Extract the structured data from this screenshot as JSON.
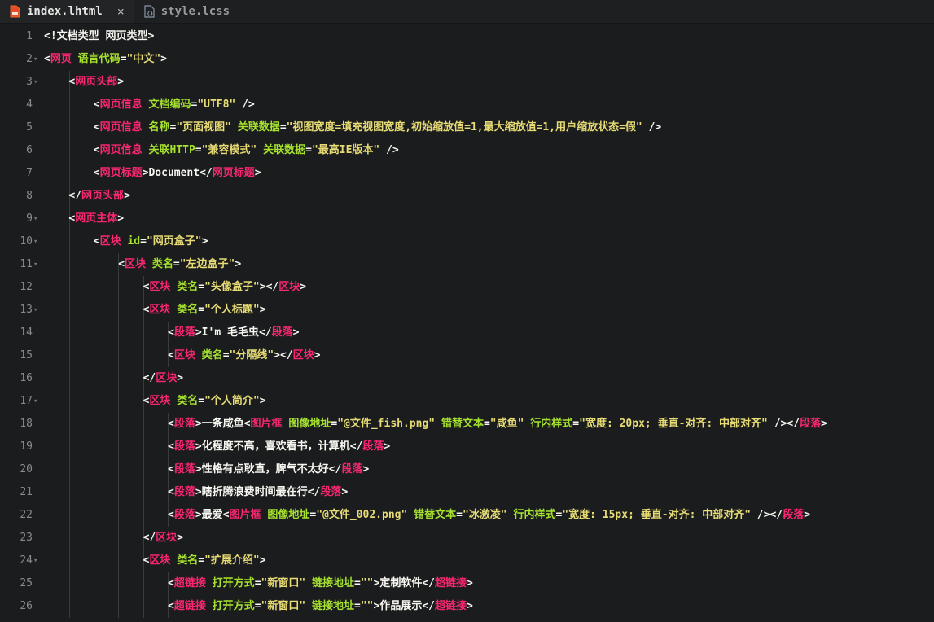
{
  "tabs": [
    {
      "label": "index.lhtml",
      "icon": "html-file-icon",
      "active": true
    },
    {
      "label": "style.lcss",
      "icon": "css-file-icon",
      "active": false
    }
  ],
  "close_glyph": "×",
  "lines": [
    {
      "n": "1",
      "fold": false,
      "indent": 0,
      "tokens": [
        [
          "p",
          "<!文档类型 网页类型>"
        ]
      ]
    },
    {
      "n": "2",
      "fold": true,
      "indent": 0,
      "tokens": [
        [
          "p",
          "<"
        ],
        [
          "t",
          "网页"
        ],
        [
          "x",
          " "
        ],
        [
          "a",
          "语言代码"
        ],
        [
          "p",
          "="
        ],
        [
          "s",
          "\"中文\""
        ],
        [
          "p",
          ">"
        ]
      ]
    },
    {
      "n": "3",
      "fold": true,
      "indent": 1,
      "tokens": [
        [
          "p",
          "<"
        ],
        [
          "t",
          "网页头部"
        ],
        [
          "p",
          ">"
        ]
      ]
    },
    {
      "n": "4",
      "fold": false,
      "indent": 2,
      "tokens": [
        [
          "p",
          "<"
        ],
        [
          "t",
          "网页信息"
        ],
        [
          "x",
          " "
        ],
        [
          "a",
          "文档编码"
        ],
        [
          "p",
          "="
        ],
        [
          "s",
          "\"UTF8\""
        ],
        [
          "x",
          " "
        ],
        [
          "p",
          "/>"
        ]
      ]
    },
    {
      "n": "5",
      "fold": false,
      "indent": 2,
      "tokens": [
        [
          "p",
          "<"
        ],
        [
          "t",
          "网页信息"
        ],
        [
          "x",
          " "
        ],
        [
          "a",
          "名称"
        ],
        [
          "p",
          "="
        ],
        [
          "s",
          "\"页面视图\""
        ],
        [
          "x",
          " "
        ],
        [
          "a",
          "关联数据"
        ],
        [
          "p",
          "="
        ],
        [
          "s",
          "\"视图宽度=填充视图宽度,初始缩放值=1,最大缩放值=1,用户缩放状态=假\""
        ],
        [
          "x",
          " "
        ],
        [
          "p",
          "/>"
        ]
      ]
    },
    {
      "n": "6",
      "fold": false,
      "indent": 2,
      "tokens": [
        [
          "p",
          "<"
        ],
        [
          "t",
          "网页信息"
        ],
        [
          "x",
          " "
        ],
        [
          "a",
          "关联HTTP"
        ],
        [
          "p",
          "="
        ],
        [
          "s",
          "\"兼容模式\""
        ],
        [
          "x",
          " "
        ],
        [
          "a",
          "关联数据"
        ],
        [
          "p",
          "="
        ],
        [
          "s",
          "\"最高IE版本\""
        ],
        [
          "x",
          " "
        ],
        [
          "p",
          "/>"
        ]
      ]
    },
    {
      "n": "7",
      "fold": false,
      "indent": 2,
      "tokens": [
        [
          "p",
          "<"
        ],
        [
          "t",
          "网页标题"
        ],
        [
          "p",
          ">"
        ],
        [
          "x",
          "Document"
        ],
        [
          "p",
          "</"
        ],
        [
          "t",
          "网页标题"
        ],
        [
          "p",
          ">"
        ]
      ]
    },
    {
      "n": "8",
      "fold": false,
      "indent": 1,
      "tokens": [
        [
          "p",
          "</"
        ],
        [
          "t",
          "网页头部"
        ],
        [
          "p",
          ">"
        ]
      ]
    },
    {
      "n": "9",
      "fold": true,
      "indent": 1,
      "tokens": [
        [
          "p",
          "<"
        ],
        [
          "t",
          "网页主体"
        ],
        [
          "p",
          ">"
        ]
      ]
    },
    {
      "n": "10",
      "fold": true,
      "indent": 2,
      "tokens": [
        [
          "p",
          "<"
        ],
        [
          "t",
          "区块"
        ],
        [
          "x",
          " "
        ],
        [
          "a",
          "id"
        ],
        [
          "p",
          "="
        ],
        [
          "s",
          "\"网页盒子\""
        ],
        [
          "p",
          ">"
        ]
      ]
    },
    {
      "n": "11",
      "fold": true,
      "indent": 3,
      "tokens": [
        [
          "p",
          "<"
        ],
        [
          "t",
          "区块"
        ],
        [
          "x",
          " "
        ],
        [
          "a",
          "类名"
        ],
        [
          "p",
          "="
        ],
        [
          "s",
          "\"左边盒子\""
        ],
        [
          "p",
          ">"
        ]
      ]
    },
    {
      "n": "12",
      "fold": false,
      "indent": 4,
      "tokens": [
        [
          "p",
          "<"
        ],
        [
          "t",
          "区块"
        ],
        [
          "x",
          " "
        ],
        [
          "a",
          "类名"
        ],
        [
          "p",
          "="
        ],
        [
          "s",
          "\"头像盒子\""
        ],
        [
          "p",
          "></"
        ],
        [
          "t",
          "区块"
        ],
        [
          "p",
          ">"
        ]
      ]
    },
    {
      "n": "13",
      "fold": true,
      "indent": 4,
      "tokens": [
        [
          "p",
          "<"
        ],
        [
          "t",
          "区块"
        ],
        [
          "x",
          " "
        ],
        [
          "a",
          "类名"
        ],
        [
          "p",
          "="
        ],
        [
          "s",
          "\"个人标题\""
        ],
        [
          "p",
          ">"
        ]
      ]
    },
    {
      "n": "14",
      "fold": false,
      "indent": 5,
      "tokens": [
        [
          "p",
          "<"
        ],
        [
          "t",
          "段落"
        ],
        [
          "p",
          ">"
        ],
        [
          "x",
          "I'm 毛毛虫"
        ],
        [
          "p",
          "</"
        ],
        [
          "t",
          "段落"
        ],
        [
          "p",
          ">"
        ]
      ]
    },
    {
      "n": "15",
      "fold": false,
      "indent": 5,
      "tokens": [
        [
          "p",
          "<"
        ],
        [
          "t",
          "区块"
        ],
        [
          "x",
          " "
        ],
        [
          "a",
          "类名"
        ],
        [
          "p",
          "="
        ],
        [
          "s",
          "\"分隔线\""
        ],
        [
          "p",
          "></"
        ],
        [
          "t",
          "区块"
        ],
        [
          "p",
          ">"
        ]
      ]
    },
    {
      "n": "16",
      "fold": false,
      "indent": 4,
      "tokens": [
        [
          "p",
          "</"
        ],
        [
          "t",
          "区块"
        ],
        [
          "p",
          ">"
        ]
      ]
    },
    {
      "n": "17",
      "fold": true,
      "indent": 4,
      "tokens": [
        [
          "p",
          "<"
        ],
        [
          "t",
          "区块"
        ],
        [
          "x",
          " "
        ],
        [
          "a",
          "类名"
        ],
        [
          "p",
          "="
        ],
        [
          "s",
          "\"个人简介\""
        ],
        [
          "p",
          ">"
        ]
      ]
    },
    {
      "n": "18",
      "fold": false,
      "indent": 5,
      "tokens": [
        [
          "p",
          "<"
        ],
        [
          "t",
          "段落"
        ],
        [
          "p",
          ">"
        ],
        [
          "x",
          "一条咸鱼"
        ],
        [
          "p",
          "<"
        ],
        [
          "t",
          "图片框"
        ],
        [
          "x",
          " "
        ],
        [
          "a",
          "图像地址"
        ],
        [
          "p",
          "="
        ],
        [
          "s",
          "\"@文件_fish.png\""
        ],
        [
          "x",
          " "
        ],
        [
          "a",
          "错替文本"
        ],
        [
          "p",
          "="
        ],
        [
          "s",
          "\"咸鱼\""
        ],
        [
          "x",
          " "
        ],
        [
          "a",
          "行内样式"
        ],
        [
          "p",
          "="
        ],
        [
          "s",
          "\"宽度: 20px; 垂直-对齐: 中部对齐\""
        ],
        [
          "x",
          " "
        ],
        [
          "p",
          "/></"
        ],
        [
          "t",
          "段落"
        ],
        [
          "p",
          ">"
        ]
      ]
    },
    {
      "n": "19",
      "fold": false,
      "indent": 5,
      "tokens": [
        [
          "p",
          "<"
        ],
        [
          "t",
          "段落"
        ],
        [
          "p",
          ">"
        ],
        [
          "x",
          "化程度不高，喜欢看书，计算机"
        ],
        [
          "p",
          "</"
        ],
        [
          "t",
          "段落"
        ],
        [
          "p",
          ">"
        ]
      ]
    },
    {
      "n": "20",
      "fold": false,
      "indent": 5,
      "tokens": [
        [
          "p",
          "<"
        ],
        [
          "t",
          "段落"
        ],
        [
          "p",
          ">"
        ],
        [
          "x",
          "性格有点耿直，脾气不太好"
        ],
        [
          "p",
          "</"
        ],
        [
          "t",
          "段落"
        ],
        [
          "p",
          ">"
        ]
      ]
    },
    {
      "n": "21",
      "fold": false,
      "indent": 5,
      "tokens": [
        [
          "p",
          "<"
        ],
        [
          "t",
          "段落"
        ],
        [
          "p",
          ">"
        ],
        [
          "x",
          "瞎折腾浪费时间最在行"
        ],
        [
          "p",
          "</"
        ],
        [
          "t",
          "段落"
        ],
        [
          "p",
          ">"
        ]
      ]
    },
    {
      "n": "22",
      "fold": false,
      "indent": 5,
      "tokens": [
        [
          "p",
          "<"
        ],
        [
          "t",
          "段落"
        ],
        [
          "p",
          ">"
        ],
        [
          "x",
          "最爱"
        ],
        [
          "p",
          "<"
        ],
        [
          "t",
          "图片框"
        ],
        [
          "x",
          " "
        ],
        [
          "a",
          "图像地址"
        ],
        [
          "p",
          "="
        ],
        [
          "s",
          "\"@文件_002.png\""
        ],
        [
          "x",
          " "
        ],
        [
          "a",
          "错替文本"
        ],
        [
          "p",
          "="
        ],
        [
          "s",
          "\"冰激凌\""
        ],
        [
          "x",
          " "
        ],
        [
          "a",
          "行内样式"
        ],
        [
          "p",
          "="
        ],
        [
          "s",
          "\"宽度: 15px; 垂直-对齐: 中部对齐\""
        ],
        [
          "x",
          " "
        ],
        [
          "p",
          "/></"
        ],
        [
          "t",
          "段落"
        ],
        [
          "p",
          ">"
        ]
      ]
    },
    {
      "n": "23",
      "fold": false,
      "indent": 4,
      "tokens": [
        [
          "p",
          "</"
        ],
        [
          "t",
          "区块"
        ],
        [
          "p",
          ">"
        ]
      ]
    },
    {
      "n": "24",
      "fold": true,
      "indent": 4,
      "tokens": [
        [
          "p",
          "<"
        ],
        [
          "t",
          "区块"
        ],
        [
          "x",
          " "
        ],
        [
          "a",
          "类名"
        ],
        [
          "p",
          "="
        ],
        [
          "s",
          "\"扩展介绍\""
        ],
        [
          "p",
          ">"
        ]
      ]
    },
    {
      "n": "25",
      "fold": false,
      "indent": 5,
      "tokens": [
        [
          "p",
          "<"
        ],
        [
          "t",
          "超链接"
        ],
        [
          "x",
          " "
        ],
        [
          "a",
          "打开方式"
        ],
        [
          "p",
          "="
        ],
        [
          "s",
          "\"新窗口\""
        ],
        [
          "x",
          " "
        ],
        [
          "a",
          "链接地址"
        ],
        [
          "p",
          "="
        ],
        [
          "s",
          "\"\""
        ],
        [
          "p",
          ">"
        ],
        [
          "x",
          "定制软件"
        ],
        [
          "p",
          "</"
        ],
        [
          "t",
          "超链接"
        ],
        [
          "p",
          ">"
        ]
      ]
    },
    {
      "n": "26",
      "fold": false,
      "indent": 5,
      "tokens": [
        [
          "p",
          "<"
        ],
        [
          "t",
          "超链接"
        ],
        [
          "x",
          " "
        ],
        [
          "a",
          "打开方式"
        ],
        [
          "p",
          "="
        ],
        [
          "s",
          "\"新窗口\""
        ],
        [
          "x",
          " "
        ],
        [
          "a",
          "链接地址"
        ],
        [
          "p",
          "="
        ],
        [
          "s",
          "\"\""
        ],
        [
          "p",
          ">"
        ],
        [
          "x",
          "作品展示"
        ],
        [
          "p",
          "</"
        ],
        [
          "t",
          "超链接"
        ],
        [
          "p",
          ">"
        ]
      ]
    }
  ]
}
